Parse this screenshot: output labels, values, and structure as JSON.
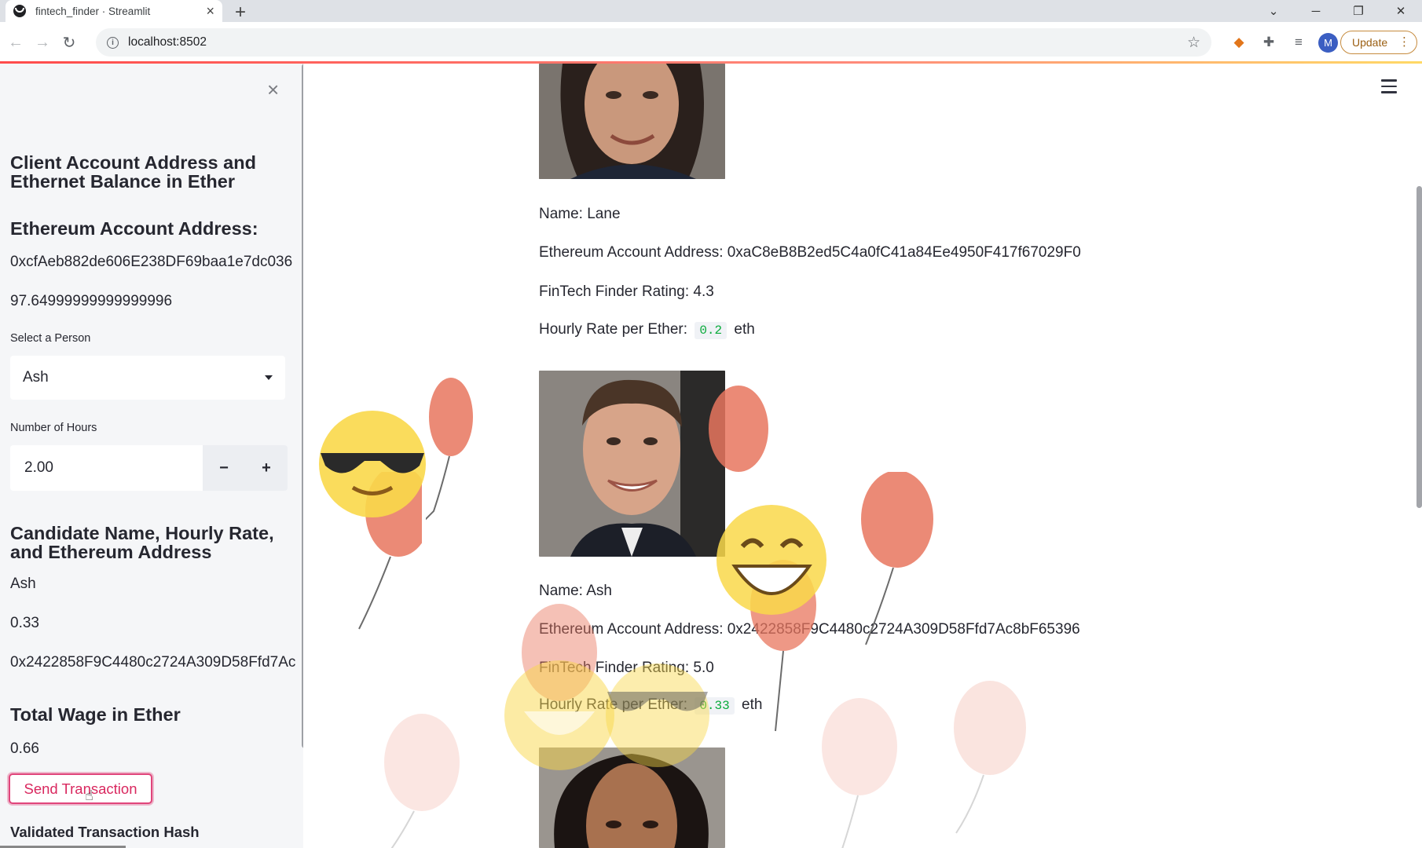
{
  "browser": {
    "tab_title": "fintech_finder · Streamlit",
    "url": "localhost:8502",
    "update_label": "Update",
    "avatar_letter": "M"
  },
  "sidebar": {
    "heading_client": "Client Account Address and Ethernet Balance in Ether",
    "heading_address": "Ethereum Account Address:",
    "client_address": "0xcfAeb882de606E238DF69baa1e7dc036",
    "client_balance": "97.64999999999999996",
    "select_label": "Select a Person",
    "select_value": "Ash",
    "hours_label": "Number of Hours",
    "hours_value": "2.00",
    "minus": "−",
    "plus": "+",
    "heading_candidate": "Candidate Name, Hourly Rate, and Ethereum Address",
    "candidate_name": "Ash",
    "candidate_rate": "0.33",
    "candidate_address": "0x2422858F9C4480c2724A309D58Ffd7Ac",
    "heading_wage": "Total Wage in Ether",
    "wage_value": "0.66",
    "send_button": "Send Transaction",
    "heading_hash": "Validated Transaction Hash"
  },
  "main": {
    "people": [
      {
        "name": "Name: Lane",
        "address": "Ethereum Account Address: 0xaC8eB8B2ed5C4a0fC41a84Ee4950F417f67029F0",
        "rating": "FinTech Finder Rating: 4.3",
        "rate_prefix": "Hourly Rate per Ether:",
        "rate_value": "0.2",
        "rate_suffix": "eth"
      },
      {
        "name": "Name: Ash",
        "address": "Ethereum Account Address: 0x2422858F9C4480c2724A309D58Ffd7Ac8bF65396",
        "rating": "FinTech Finder Rating: 5.0",
        "rate_prefix": "Hourly Rate per Ether:",
        "rate_value": "0.33",
        "rate_suffix": "eth"
      }
    ]
  },
  "colors": {
    "accent": "#e0457b",
    "sidebar_bg": "#f5f6f8",
    "code_green": "#09ab3b",
    "balloon": "#e8765e"
  }
}
